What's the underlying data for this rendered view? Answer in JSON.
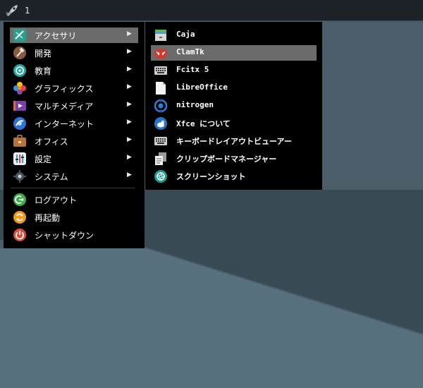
{
  "panel": {
    "workspace_number": "1",
    "launcher_icon": "rocket-icon"
  },
  "menu": {
    "categories": [
      {
        "label": "アクセサリ",
        "icon": "accessories-icon",
        "selected": true
      },
      {
        "label": "開発",
        "icon": "hammer-icon"
      },
      {
        "label": "教育",
        "icon": "education-icon"
      },
      {
        "label": "グラフィックス",
        "icon": "graphics-icon"
      },
      {
        "label": "マルチメディア",
        "icon": "multimedia-icon"
      },
      {
        "label": "インターネット",
        "icon": "internet-icon"
      },
      {
        "label": "オフィス",
        "icon": "briefcase-icon"
      },
      {
        "label": "設定",
        "icon": "settings-icon"
      },
      {
        "label": "システム",
        "icon": "gear-icon"
      }
    ],
    "actions": [
      {
        "label": "ログアウト",
        "icon": "logout-icon"
      },
      {
        "label": "再起動",
        "icon": "restart-icon"
      },
      {
        "label": "シャットダウン",
        "icon": "power-icon"
      }
    ]
  },
  "submenu": {
    "items": [
      {
        "label": "Caja",
        "icon": "file-manager-icon"
      },
      {
        "label": "ClamTk",
        "icon": "clamtk-icon",
        "selected": true
      },
      {
        "label": "Fcitx 5",
        "icon": "keyboard-icon"
      },
      {
        "label": "LibreOffice",
        "icon": "document-icon"
      },
      {
        "label": "nitrogen",
        "icon": "nitrogen-icon"
      },
      {
        "label": "Xfce について",
        "icon": "xfce-icon"
      },
      {
        "label": "キーボードレイアウトビューアー",
        "icon": "keyboard-layout-icon"
      },
      {
        "label": "クリップボードマネージャー",
        "icon": "clipboard-icon"
      },
      {
        "label": "スクリーンショット",
        "icon": "screenshot-icon"
      }
    ]
  },
  "colors": {
    "panel_border": "#b21616",
    "menu_bg": "#000000",
    "selection": "#6b6b6b"
  }
}
